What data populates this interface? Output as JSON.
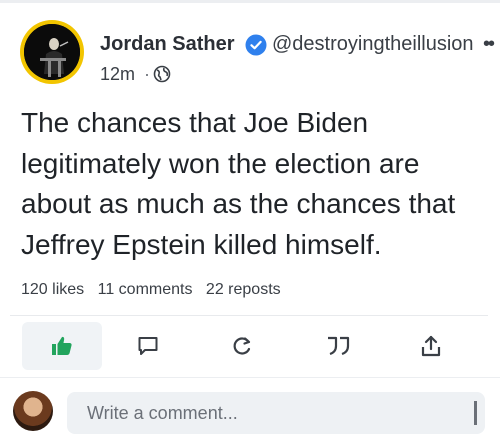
{
  "post": {
    "author_name": "Jordan Sather",
    "author_handle": "@destroyingtheillusion",
    "time": "12m",
    "separator": "·",
    "body": "The chances that Joe Biden legitimately won the election are about as much as the chances that Jeffrey Epstein killed himself.",
    "stats": {
      "likes": "120 likes",
      "comments": "11 comments",
      "reposts": "22 reposts"
    }
  },
  "actions": {
    "like_icon": "thumbs-up-icon",
    "comment_icon": "comment-icon",
    "repost_icon": "repost-icon",
    "quote_icon": "quote-icon",
    "share_icon": "share-icon"
  },
  "composer": {
    "placeholder": "Write a comment..."
  },
  "colors": {
    "like_active": "#22a45d",
    "verified": "#2f80ed",
    "avatar_ring": "#f2c500",
    "icon": "#3a3f46"
  }
}
